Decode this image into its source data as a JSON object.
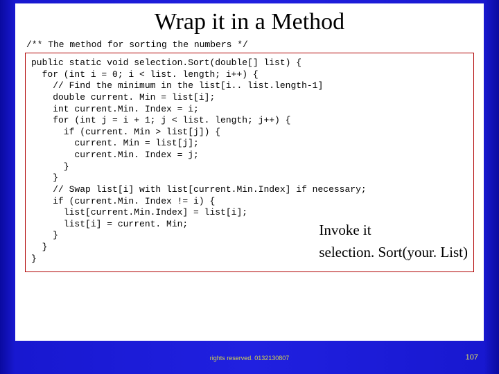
{
  "title": "Wrap it in a Method",
  "comment": "/** The method for sorting the numbers */",
  "code": "public static void selection.Sort(double[] list) {\n  for (int i = 0; i < list. length; i++) {\n    // Find the minimum in the list[i.. list.length-1]\n    double current. Min = list[i];\n    int current.Min. Index = i;\n    for (int j = i + 1; j < list. length; j++) {\n      if (current. Min > list[j]) {\n        current. Min = list[j];\n        current.Min. Index = j;\n      }\n    }\n    // Swap list[i] with list[current.Min.Index] if necessary;\n    if (current.Min. Index != i) {\n      list[current.Min.Index] = list[i];\n      list[i] = current. Min;\n    }\n  }\n}",
  "annotation_line1": "Invoke it",
  "annotation_line2": "selection. Sort(your. List)",
  "footer": "rights reserved. 0132130807",
  "pagenum": "107"
}
